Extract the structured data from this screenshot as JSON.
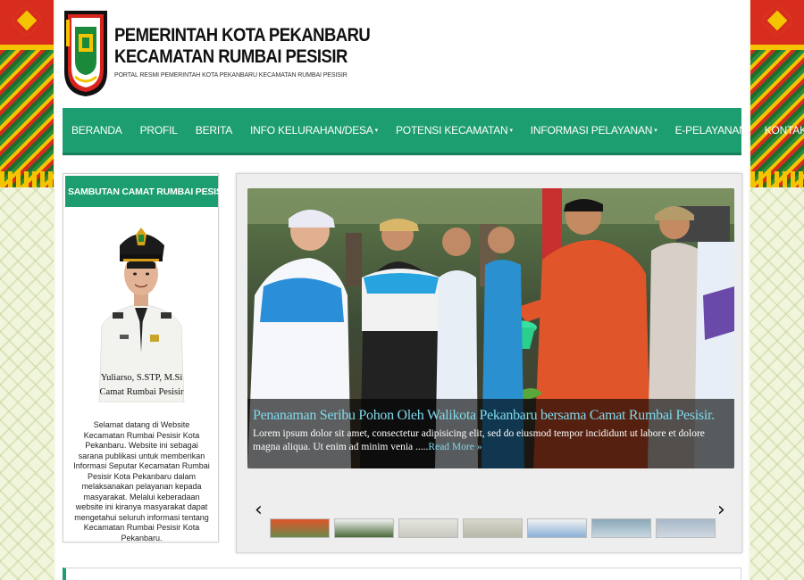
{
  "header": {
    "title_line1": "PEMERINTAH KOTA PEKANBARU",
    "title_line2": "KECAMATAN RUMBAI PESISIR",
    "tagline": "PORTAL RESMI PEMERINTAH KOTA PEKANBARU KECAMATAN RUMBAI PESISIR"
  },
  "nav": {
    "items": [
      {
        "label": "BERANDA",
        "dropdown": false
      },
      {
        "label": "PROFIL",
        "dropdown": false
      },
      {
        "label": "BERITA",
        "dropdown": false
      },
      {
        "label": "INFO KELURAHAN/DESA",
        "dropdown": true
      },
      {
        "label": "POTENSI KECAMATAN",
        "dropdown": true
      },
      {
        "label": "INFORMASI PELAYANAN",
        "dropdown": true
      },
      {
        "label": "E-PELAYANAN",
        "dropdown": false
      },
      {
        "label": "KONTAK KAMI",
        "dropdown": true
      }
    ],
    "caret": "▾"
  },
  "sidebar": {
    "heading": "SAMBUTAN CAMAT RUMBAI PESISIR",
    "name": "Yuliarso, S.STP, M.Si",
    "position": "Camat Rumbai Pesisir",
    "welcome_text": "Selamat datang di Website Kecamatan Rumbai Pesisir Kota Pekanbaru. Website ini sebagai sarana publikasi untuk memberikan Informasi Seputar Kecamatan Rumbai Pesisir Kota Pekanbaru dalam melaksanakan pelayanan kepada masyarakat. Melalui keberadaan website ini kiranya masyarakat dapat mengetahui seluruh informasi tentang Kecamatan Rumbai Pesisir Kota Pekanbaru."
  },
  "slider": {
    "caption_title": "Penanaman Seribu Pohon Oleh Walikota Pekanbaru bersama Camat Rumbai Pesisir.",
    "caption_text": "Lorem ipsum dolor sit amet, consectetur adipisicing elit, sed do eiusmod tempor incididunt ut labore et dolore magna aliqua. Ut enim ad minim venia .....",
    "read_more": "Read More »",
    "prev_arrow": "‹",
    "next_arrow": "›",
    "thumb_count": 7
  },
  "colors": {
    "primary_green": "#1d9e70",
    "caption_link": "#7fd9ec"
  }
}
